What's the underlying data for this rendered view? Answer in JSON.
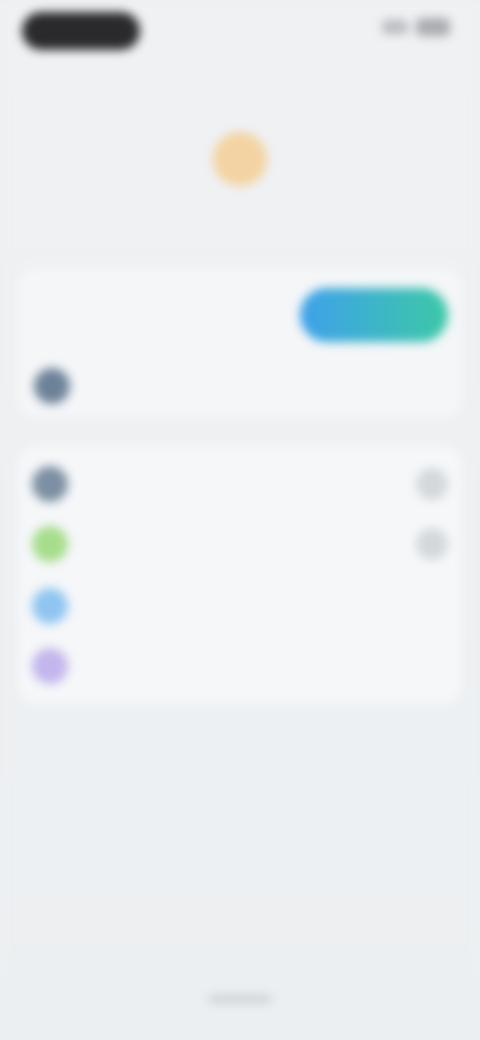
{
  "header": {
    "title": ""
  },
  "hero": {
    "caption": ""
  },
  "card_top": {
    "label_line1": "",
    "label_line2": "",
    "cta_label": "",
    "row_label": "",
    "row_color": "#6d8299"
  },
  "list": {
    "items": [
      {
        "label": "",
        "color": "#7d8fa3",
        "has_action": true
      },
      {
        "label": "",
        "color": "#a6dd8b",
        "has_action": true
      },
      {
        "label": "",
        "color": "#8fc5f0",
        "has_action": false
      },
      {
        "label": "",
        "color": "#c3b6ec",
        "has_action": false
      }
    ]
  },
  "colors": {
    "accent_start": "#3ea1ea",
    "accent_end": "#3cc8a7",
    "hero_icon": "#f4d3a2"
  }
}
